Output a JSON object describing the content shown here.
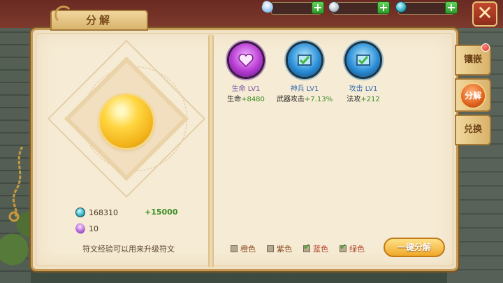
{
  "top_bar": {
    "resources": [
      {
        "icon": "white-gem-icon",
        "value": ""
      },
      {
        "icon": "silver-coin-icon",
        "value": ""
      },
      {
        "icon": "teal-rune-stone-icon",
        "value": ""
      }
    ],
    "close_glyph": "✕"
  },
  "panel": {
    "title": "分解",
    "materials": {
      "rune_stone": "168310",
      "rune_stone_gain": "+15000",
      "crystal": "10"
    },
    "hint": "符文经验可以用来升级符文"
  },
  "runes": [
    {
      "name": "生命 LV1",
      "stat": "生命",
      "bonus": "+8480",
      "color": "purple",
      "icon": "heart-rune-icon"
    },
    {
      "name": "神兵 LV1",
      "stat": "武器攻击",
      "bonus": "+7.13%",
      "color": "blue",
      "icon": "sword-rune-icon"
    },
    {
      "name": "攻击 LV1",
      "stat": "法攻",
      "bonus": "+212",
      "color": "blue",
      "icon": "attack-rune-icon"
    }
  ],
  "filters": [
    {
      "label": "橙色",
      "checked": false
    },
    {
      "label": "紫色",
      "checked": false
    },
    {
      "label": "蓝色",
      "checked": true
    },
    {
      "label": "绿色",
      "checked": true
    }
  ],
  "decompose_button": "一键分解",
  "side_tabs": [
    "镶嵌",
    "分解",
    "兑换"
  ],
  "colors": {
    "accent": "#f0a829",
    "panel_bg": "#f6ebd4",
    "gain_green": "#3f8f2a"
  }
}
